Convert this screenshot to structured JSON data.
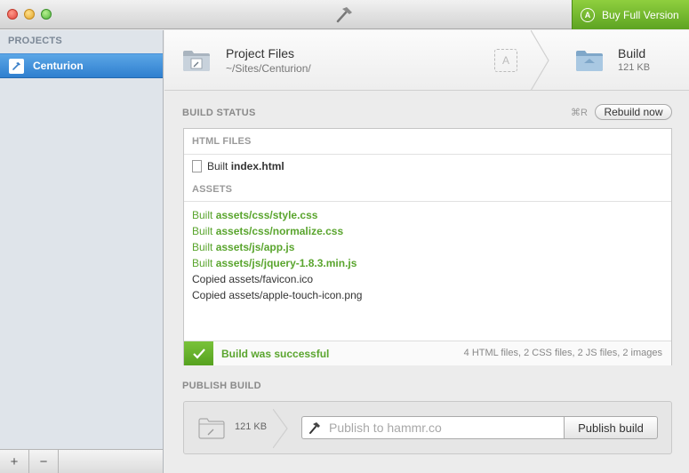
{
  "titlebar": {
    "buy_label": "Buy Full Version",
    "accent": "#6bb22b"
  },
  "sidebar": {
    "header": "PROJECTS",
    "items": [
      {
        "label": "Centurion",
        "selected": true,
        "icon": "hammer-icon"
      }
    ],
    "add_label": "+",
    "remove_label": "−"
  },
  "pathbar": {
    "source_title": "Project Files",
    "source_path": "~/Sites/Centurion/",
    "build_title": "Build",
    "build_size": "121 KB"
  },
  "build_status": {
    "label": "BUILD STATUS",
    "shortcut": "⌘R",
    "rebuild_label": "Rebuild now",
    "html_header": "HTML FILES",
    "html_files": [
      {
        "prefix": "Built",
        "name": "index.html"
      }
    ],
    "assets_header": "ASSETS",
    "assets": [
      {
        "prefix": "Built",
        "name": "assets/css/style.css",
        "kind": "built"
      },
      {
        "prefix": "Built",
        "name": "assets/css/normalize.css",
        "kind": "built"
      },
      {
        "prefix": "Built",
        "name": "assets/js/app.js",
        "kind": "built"
      },
      {
        "prefix": "Built",
        "name": "assets/js/jquery-1.8.3.min.js",
        "kind": "built"
      },
      {
        "text": "Copied assets/favicon.ico",
        "kind": "copied"
      },
      {
        "text": "Copied assets/apple-touch-icon.png",
        "kind": "copied"
      }
    ],
    "success_text": "Build was successful",
    "summary": "4 HTML files, 2 CSS files, 2 JS files, 2 images",
    "success_color": "#5aa52e"
  },
  "publish": {
    "label": "PUBLISH BUILD",
    "size": "121 KB",
    "placeholder": "Publish to hammr.co",
    "button_label": "Publish build"
  }
}
